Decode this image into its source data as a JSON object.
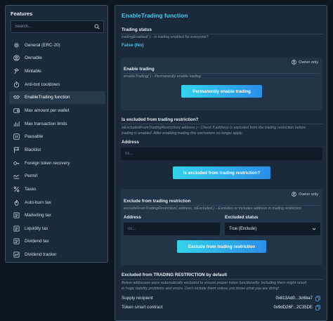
{
  "sidebar": {
    "title": "Features",
    "search_placeholder": "Search...",
    "items": [
      {
        "label": "General (ERC-20)",
        "icon": "gear-icon"
      },
      {
        "label": "Ownable",
        "icon": "user-circle-icon"
      },
      {
        "label": "Mintable",
        "icon": "hammer-icon"
      },
      {
        "label": "Anti-bot cooldown",
        "icon": "stopwatch-icon"
      },
      {
        "label": "EnableTrading function",
        "icon": "handshake-icon",
        "active": true
      },
      {
        "label": "Max amount per wallet",
        "icon": "wallet-icon"
      },
      {
        "label": "Max transaction limits",
        "icon": "bar-chart-icon"
      },
      {
        "label": "Pausable",
        "icon": "pause-icon"
      },
      {
        "label": "Blacklist",
        "icon": "flag-icon"
      },
      {
        "label": "Foreign token recovery",
        "icon": "key-icon"
      },
      {
        "label": "Permit",
        "icon": "signature-icon"
      },
      {
        "label": "Taxes",
        "icon": "percent-icon"
      },
      {
        "label": "Auto-burn tax",
        "icon": "fire-icon"
      },
      {
        "label": "Marketing tax",
        "icon": "receipt-icon"
      },
      {
        "label": "Liquidity tax",
        "icon": "receipt-icon"
      },
      {
        "label": "Dividend tax",
        "icon": "receipt-icon"
      },
      {
        "label": "Dividend tracker",
        "icon": "tracker-icon"
      }
    ]
  },
  "main": {
    "title": "EnableTrading function",
    "trading_status": {
      "title": "Trading status",
      "desc": "tradingEnabled( ) - Is trading enabled for everyone?",
      "value": "False (No)"
    },
    "enable_trading": {
      "owner_only": "Owner only",
      "title": "Enable trading",
      "desc": "enableTrading( ) - Permanently enable trading",
      "button": "Permanently enable trading"
    },
    "is_excluded": {
      "title": "Is excluded from trading restriction?",
      "desc_line1": "isExcludedFromTradingRestriction( address ) - Check if address is excluded from the trading restriction before",
      "desc_line2": "trading is enabled. After enabling trading this exclusions no longer apply.",
      "address_label": "Address",
      "address_placeholder": "0x...",
      "button": "Is excluded from trading restriction?"
    },
    "exclude": {
      "owner_only": "Owner only",
      "title": "Exclude from trading restriction",
      "desc": "excludeFromTradingRestriction( address, isExcluded ) - Excludes or includes address in trading restriction",
      "address_label": "Address",
      "address_placeholder": "0x...",
      "status_label": "Excluded status",
      "status_value": "True (Exclude)",
      "button": "Exclude from trading restriction"
    },
    "excluded_default": {
      "title": "Excluded from TRADING RESTRICTION by default",
      "desc_line1": "Below addresses were automatically excluded to ensure proper token functionality. Including them might result",
      "desc_line2": "in huge stability problems and errors. Don't include them unless you know what you are doing!",
      "rows": [
        {
          "label": "Supply recipient",
          "value": "0x813Ad0...3c6ba7"
        },
        {
          "label": "Token smart contract",
          "value": "0x9dD26F...2C35DE"
        }
      ]
    }
  },
  "colors": {
    "accent": "#49c9ee",
    "button_gradient_start": "#34d3ec",
    "button_gradient_end": "#2a8ee8",
    "panel_bg": "#1a2a3a",
    "card_bg": "#223447",
    "page_bg": "#0d1722"
  }
}
